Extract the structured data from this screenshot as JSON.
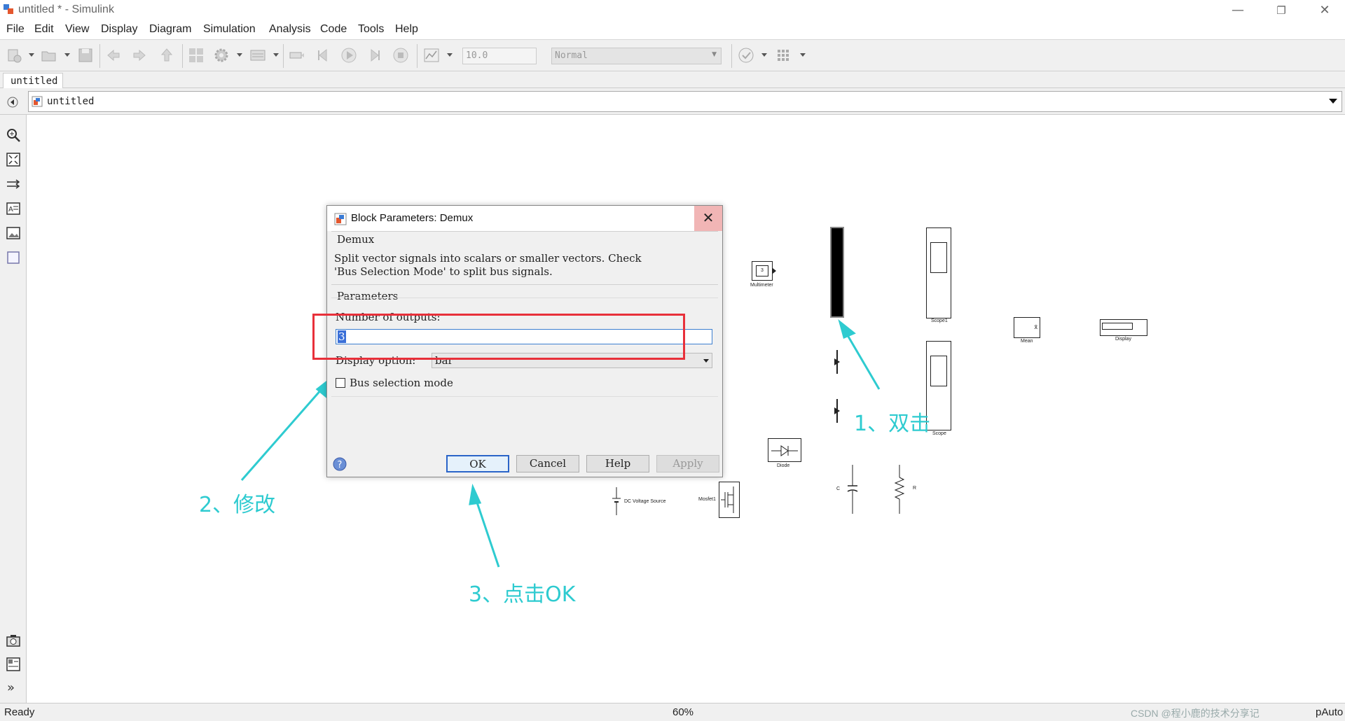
{
  "window": {
    "title": "untitled * - Simulink",
    "minimize": "—",
    "restore": "❐",
    "close": "✕"
  },
  "menu": [
    "File",
    "Edit",
    "View",
    "Display",
    "Diagram",
    "Simulation",
    "Analysis",
    "Code",
    "Tools",
    "Help"
  ],
  "toolbar": {
    "stop_time": "10.0",
    "sim_mode": "Normal"
  },
  "tab": {
    "label": "untitled"
  },
  "address": {
    "path": "untitled"
  },
  "status": {
    "left": "Ready",
    "zoom": "60%",
    "right": "pAuto",
    "watermark": "CSDN @程小鹿的技术分享记"
  },
  "blocks": {
    "multimeter": "Multimeter",
    "multimeter_value": "3",
    "scope1": "Scope1",
    "scope": "Scope",
    "mean": "Mean",
    "display": "Display",
    "diode": "Diode",
    "dc_source": "DC Voltage Source",
    "mosfet": "Mosfet1",
    "capacitor": "C",
    "resistor": "R"
  },
  "dialog": {
    "title": "Block Parameters: Demux",
    "block_type": "Demux",
    "description_line1": "Split vector signals into scalars or smaller vectors. Check",
    "description_line2": "'Bus Selection Mode' to split bus signals.",
    "params_header": "Parameters",
    "num_outputs_label": "Number of outputs:",
    "num_outputs_value": "3",
    "display_option_label": "Display option:",
    "display_option_value": "bar",
    "bus_selection_label": "Bus selection mode",
    "buttons": {
      "ok": "OK",
      "cancel": "Cancel",
      "help": "Help",
      "apply": "Apply"
    }
  },
  "annotations": {
    "step1": "1、双击",
    "step2": "2、修改",
    "step3": "3、点击OK",
    "color": "#2ecbd0",
    "box_color": "#e8303a"
  }
}
